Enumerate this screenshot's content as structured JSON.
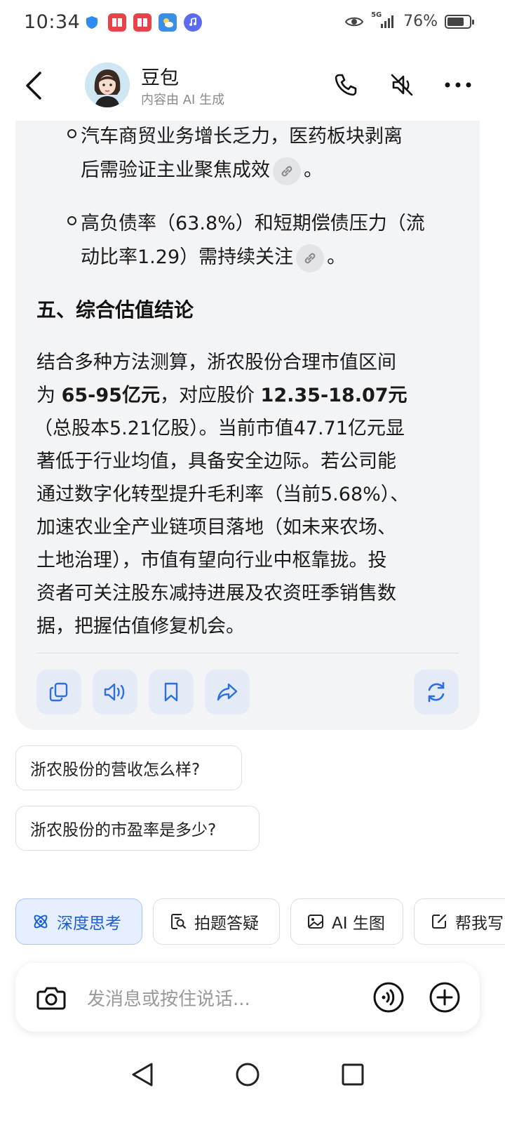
{
  "status_bar": {
    "time": "10:34",
    "network_label": "5G",
    "battery_percent": "76%",
    "battery_level": 0.76
  },
  "header": {
    "bot_name": "豆包",
    "bot_subtitle": "内容由 AI 生成",
    "icons": [
      "back-icon",
      "phone-icon",
      "mute-icon",
      "more-icon"
    ]
  },
  "message": {
    "bullets": [
      {
        "lines": [
          "汽车商贸业务增长乏力，医药板块剥离",
          "后需验证主业聚焦成效"
        ],
        "suffix": "。"
      },
      {
        "lines": [
          "高负债率（63.8%）和短期偿债压力（流",
          "动比率1.29）需持续关注"
        ],
        "suffix": "。"
      }
    ],
    "section_title": "五、综合估值结论",
    "para_line1": "结合多种方法测算，浙农股份合理市值区间",
    "para_line2_pre": "为 ",
    "para_line2_bold1": "65-95亿元",
    "para_line2_mid": "，对应股价 ",
    "para_line2_bold2": "12.35-18.07元",
    "para_lines_rest": [
      "（总股本5.21亿股）。当前市值47.71亿元显",
      "著低于行业均值，具备安全边际。若公司能",
      "通过数字化转型提升毛利率（当前5.68%）、",
      "加速农业全产业链项目落地（如未来农场、",
      "土地治理），市值有望向行业中枢靠拢。投",
      "资者可关注股东减持进展及农资旺季销售数",
      "据，把握估值修复机会。"
    ],
    "actions": [
      "copy-icon",
      "speaker-icon",
      "bookmark-icon",
      "share-icon",
      "regenerate-icon"
    ]
  },
  "suggestions": [
    "浙农股份的营收怎么样?",
    "浙农股份的市盈率是多少?"
  ],
  "tools": [
    {
      "label": "深度思考",
      "icon": "deep-think-icon",
      "active": true
    },
    {
      "label": "拍题答疑",
      "icon": "photo-question-icon",
      "active": false
    },
    {
      "label": "AI 生图",
      "icon": "image-gen-icon",
      "active": false
    },
    {
      "label": "帮我写",
      "icon": "write-icon",
      "active": false
    }
  ],
  "input": {
    "placeholder": "发消息或按住说话..."
  },
  "colors": {
    "accent": "#1a5fd6",
    "card_bg": "#f3f4f6",
    "action_bg": "#e4ebf7"
  }
}
